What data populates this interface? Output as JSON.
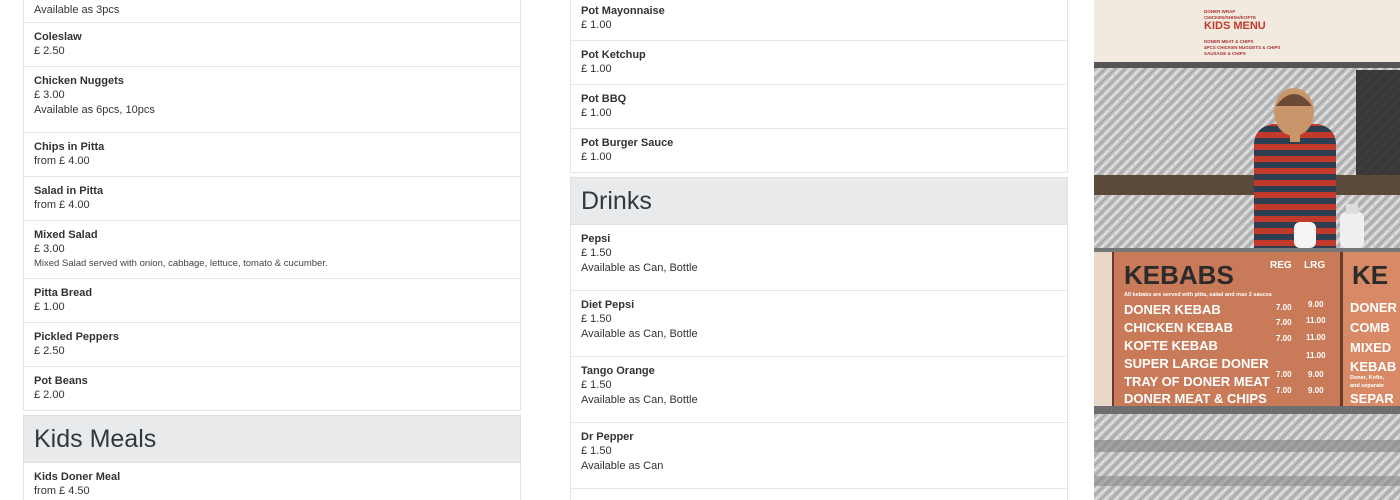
{
  "left_column": {
    "items_top": [
      {
        "name": "",
        "price": "",
        "note": "Available as 3pcs"
      },
      {
        "name": "Coleslaw",
        "price": "£ 2.50"
      },
      {
        "name": "Chicken Nuggets",
        "price": "£ 3.00",
        "note": "Available as 6pcs, 10pcs"
      },
      {
        "name": "Chips in Pitta",
        "price": "from £ 4.00"
      },
      {
        "name": "Salad in Pitta",
        "price": "from £ 4.00"
      },
      {
        "name": "Mixed Salad",
        "price": "£ 3.00",
        "desc": "Mixed Salad served with onion, cabbage, lettuce, tomato & cucumber."
      },
      {
        "name": "Pitta Bread",
        "price": "£ 1.00"
      },
      {
        "name": "Pickled Peppers",
        "price": "£ 2.50"
      },
      {
        "name": "Pot Beans",
        "price": "£ 2.00"
      }
    ],
    "section_kids": {
      "title": "Kids Meals"
    },
    "items_kids": [
      {
        "name": "Kids Doner Meal",
        "price": "from £ 4.50"
      }
    ]
  },
  "right_column": {
    "items_sauces": [
      {
        "name": "Pot Mayonnaise",
        "price": "£ 1.00"
      },
      {
        "name": "Pot Ketchup",
        "price": "£ 1.00"
      },
      {
        "name": "Pot BBQ",
        "price": "£ 1.00"
      },
      {
        "name": "Pot Burger Sauce",
        "price": "£ 1.00"
      }
    ],
    "section_drinks": {
      "title": "Drinks"
    },
    "items_drinks": [
      {
        "name": "Pepsi",
        "price": "£ 1.50",
        "note": "Available as Can, Bottle"
      },
      {
        "name": "Diet Pepsi",
        "price": "£ 1.50",
        "note": "Available as Can, Bottle"
      },
      {
        "name": "Tango Orange",
        "price": "£ 1.50",
        "note": "Available as Can, Bottle"
      },
      {
        "name": "Dr Pepper",
        "price": "£ 1.50",
        "note": "Available as Can"
      }
    ]
  },
  "photos": {
    "kids_board": {
      "heading": "KIDS MENU",
      "lines": [
        "DONER WRAP",
        "CHICKEN/SHISH/KOFTE",
        "DONER MEAT & CHIPS",
        "4PCS CHICKEN NUGGETS & CHIPS",
        "SAUSAGE & CHIPS"
      ]
    },
    "kebab_board": {
      "heading": "KEBABS",
      "col_reg": "REG",
      "col_lrg": "LRG",
      "note": "All kebabs are served with pitta, salad and max 2 sauces",
      "rows": [
        {
          "name": "DONER KEBAB",
          "reg": "7.00",
          "lrg": "9.00"
        },
        {
          "name": "CHICKEN KEBAB",
          "reg": "7.00",
          "lrg": "11.00"
        },
        {
          "name": "KOFTE KEBAB",
          "reg": "7.00",
          "lrg": "11.00"
        },
        {
          "name": "SUPER LARGE DONER",
          "reg": "",
          "lrg": "11.00"
        },
        {
          "name": "TRAY OF DONER MEAT",
          "reg": "7.00",
          "lrg": "9.00"
        },
        {
          "name": "DONER MEAT & CHIPS",
          "reg": "7.00",
          "lrg": "9.00"
        }
      ],
      "side_lines": [
        "KE",
        "DONER",
        "COMB",
        "MIXED",
        "KEBAB",
        "Doner, Kofte,",
        "and separate",
        "SEPAR"
      ]
    }
  }
}
